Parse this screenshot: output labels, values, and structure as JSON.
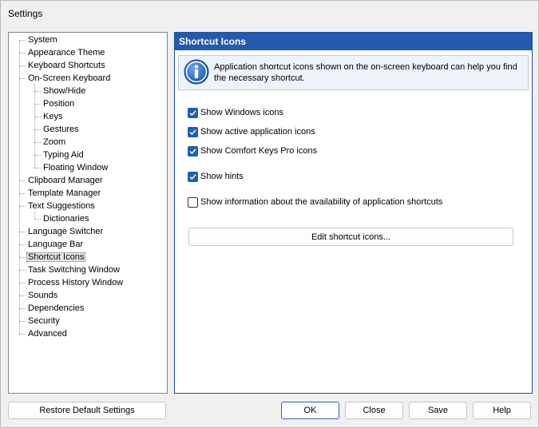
{
  "window": {
    "title": "Settings"
  },
  "tree": {
    "items": [
      {
        "label": "System",
        "level": 0
      },
      {
        "label": "Appearance Theme",
        "level": 0
      },
      {
        "label": "Keyboard Shortcuts",
        "level": 0
      },
      {
        "label": "On-Screen Keyboard",
        "level": 0
      },
      {
        "label": "Show/Hide",
        "level": 1
      },
      {
        "label": "Position",
        "level": 1
      },
      {
        "label": "Keys",
        "level": 1
      },
      {
        "label": "Gestures",
        "level": 1
      },
      {
        "label": "Zoom",
        "level": 1
      },
      {
        "label": "Typing Aid",
        "level": 1
      },
      {
        "label": "Floating Window",
        "level": 1
      },
      {
        "label": "Clipboard Manager",
        "level": 0
      },
      {
        "label": "Template Manager",
        "level": 0
      },
      {
        "label": "Text Suggestions",
        "level": 0
      },
      {
        "label": "Dictionaries",
        "level": 1
      },
      {
        "label": "Language Switcher",
        "level": 0
      },
      {
        "label": "Language Bar",
        "level": 0
      },
      {
        "label": "Shortcut Icons",
        "level": 0,
        "selected": true
      },
      {
        "label": "Task Switching Window",
        "level": 0
      },
      {
        "label": "Process History Window",
        "level": 0
      },
      {
        "label": "Sounds",
        "level": 0
      },
      {
        "label": "Dependencies",
        "level": 0
      },
      {
        "label": "Security",
        "level": 0
      },
      {
        "label": "Advanced",
        "level": 0
      }
    ]
  },
  "panel": {
    "title": "Shortcut Icons",
    "info_text": "Application shortcut icons shown on the on-screen keyboard can help you find the necessary shortcut.",
    "options": [
      {
        "label": "Show Windows icons",
        "checked": true
      },
      {
        "label": "Show active application icons",
        "checked": true
      },
      {
        "label": "Show Comfort Keys Pro icons",
        "checked": true
      },
      {
        "label": "Show hints",
        "checked": true
      },
      {
        "label": "Show information about the availability of application shortcuts",
        "checked": false
      }
    ],
    "edit_button": "Edit shortcut icons..."
  },
  "footer": {
    "restore": "Restore Default Settings",
    "ok": "OK",
    "close": "Close",
    "save": "Save",
    "help": "Help"
  },
  "colors": {
    "header_bg": "#2459b0",
    "checkbox_accent": "#1e5fb6"
  }
}
